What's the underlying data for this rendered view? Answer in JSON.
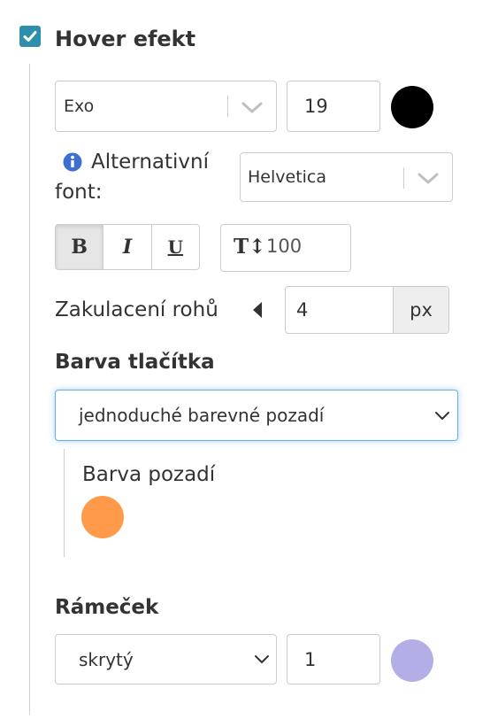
{
  "hover": {
    "title": "Hover efekt",
    "checked": true
  },
  "font": {
    "family": "Exo",
    "size": "19",
    "color": "#000000"
  },
  "alt_font": {
    "label_line1": "Alternativní",
    "label_line2": "font:",
    "family": "Helvetica"
  },
  "format": {
    "bold": "B",
    "italic": "I",
    "underline": "U",
    "line_height_icon": "T↕",
    "line_height": "100"
  },
  "radius": {
    "label": "Zakulacení rohů",
    "value": "4",
    "unit": "px"
  },
  "button_color": {
    "heading": "Barva tlačítka",
    "mode": "jednoduché barevné pozadí",
    "bg_label": "Barva pozadí",
    "bg_color": "#ff9a4a"
  },
  "border": {
    "heading": "Rámeček",
    "style": "skrytý",
    "width": "1",
    "color": "#b3aee6"
  },
  "colors": {
    "checkbox": "#2e8fad",
    "focus": "#66afe9",
    "info_icon": "#3d6fd0"
  }
}
